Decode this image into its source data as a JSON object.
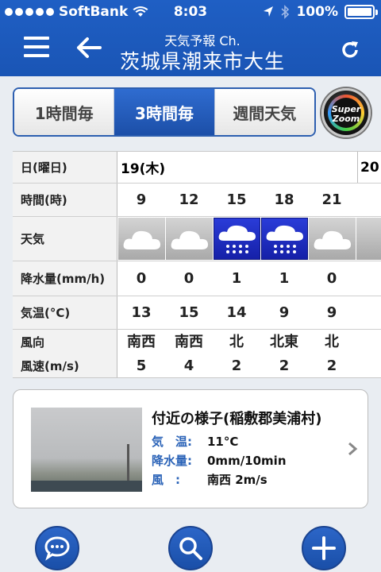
{
  "status": {
    "carrier": "SoftBank",
    "time": "8:03",
    "battery": "100%"
  },
  "nav": {
    "subtitle": "天気予報 Ch.",
    "title": "茨城県潮来市大生"
  },
  "tabs": [
    {
      "label": "1時間毎",
      "active": false
    },
    {
      "label": "3時間毎",
      "active": true
    },
    {
      "label": "週間天気",
      "active": false
    }
  ],
  "superzoom": {
    "line1": "Super",
    "line2": "Zoom"
  },
  "forecast": {
    "labels": {
      "date": "日(曜日)",
      "time": "時間(時)",
      "weather": "天気",
      "precip": "降水量(mm/h)",
      "temp": "気温(°C)",
      "wind_dir": "風向",
      "wind_speed": "風速(m/s)"
    },
    "date": "19(木)",
    "next_date": "20",
    "columns": [
      {
        "hour": "9",
        "weather": "cloudy",
        "precip": "0",
        "temp": "13",
        "wind_dir": "南西",
        "wind_speed": "5"
      },
      {
        "hour": "12",
        "weather": "cloudy",
        "precip": "0",
        "temp": "15",
        "wind_dir": "南西",
        "wind_speed": "4"
      },
      {
        "hour": "15",
        "weather": "rain",
        "precip": "1",
        "temp": "14",
        "wind_dir": "北",
        "wind_speed": "2"
      },
      {
        "hour": "18",
        "weather": "rain",
        "precip": "1",
        "temp": "9",
        "wind_dir": "北東",
        "wind_speed": "2"
      },
      {
        "hour": "21",
        "weather": "cloudy",
        "precip": "0",
        "temp": "9",
        "wind_dir": "北",
        "wind_speed": "2"
      }
    ]
  },
  "nearby": {
    "title": "付近の様子(稲敷郡美浦村)",
    "rows": [
      {
        "key": "気　温:",
        "value": "11°C"
      },
      {
        "key": "降水量:",
        "value": "0mm/10min"
      },
      {
        "key": "風　:",
        "value": "南西 2m/s"
      }
    ]
  },
  "colors": {
    "header": "#1f5fc4",
    "rain_cell": "#2a3cd8",
    "cloud_cell": "#b8b8b8"
  }
}
